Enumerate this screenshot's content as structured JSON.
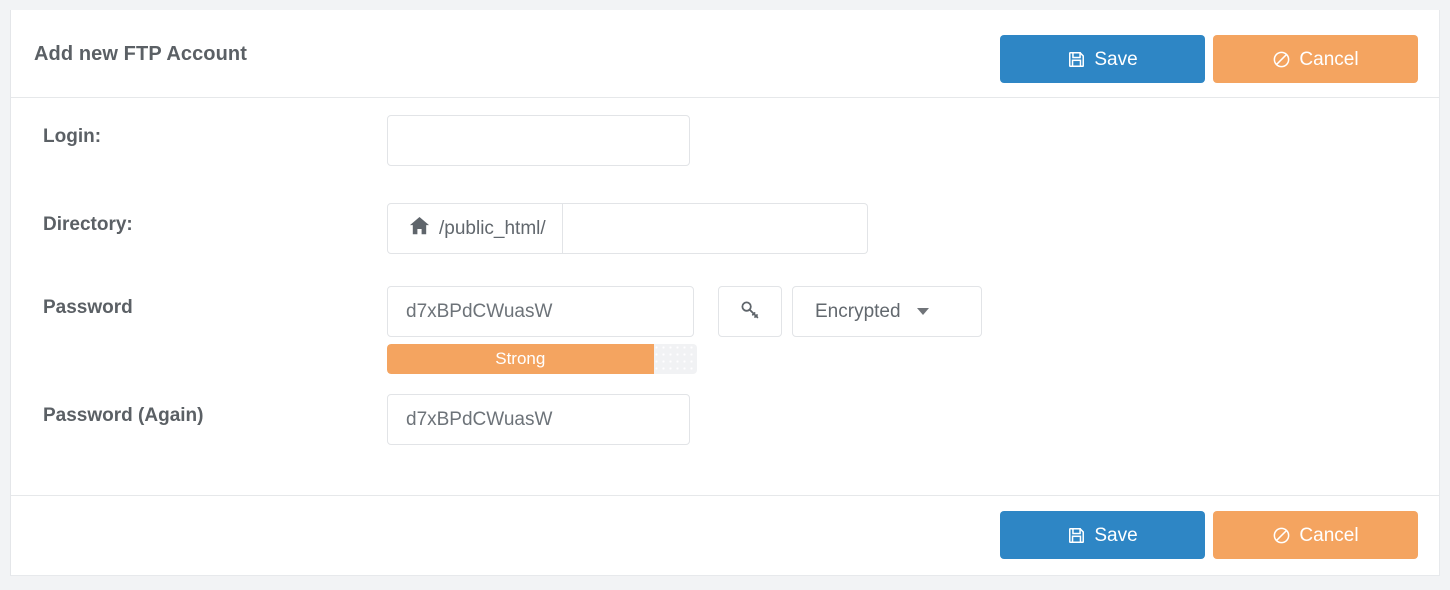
{
  "panel": {
    "title": "Add new FTP Account"
  },
  "actions": {
    "save_label": "Save",
    "cancel_label": "Cancel",
    "save_icon": "floppy-disk-save-icon",
    "cancel_icon": "ban-circle-slash-icon"
  },
  "form": {
    "login": {
      "label": "Login:",
      "value": "",
      "placeholder": ""
    },
    "directory": {
      "label": "Directory:",
      "prefix_icon": "home-icon",
      "prefix": "/public_html/",
      "value": "",
      "placeholder": ""
    },
    "password": {
      "label": "Password",
      "value": "d7xBPdCWuasW",
      "placeholder": "",
      "generate_icon": "key-icon",
      "mode_label": "Encrypted",
      "mode_caret_icon": "caret-down-icon",
      "strength": {
        "text": "Strong",
        "percent": 86
      }
    },
    "password_again": {
      "label": "Password (Again)",
      "value": "d7xBPdCWuasW",
      "placeholder": ""
    }
  },
  "colors": {
    "primary": "#2e86c5",
    "warning": "#f4a460",
    "label_text": "#5b6065",
    "border": "#e2e4e7",
    "page_bg": "#f2f3f5",
    "card_bg": "#ffffff"
  }
}
